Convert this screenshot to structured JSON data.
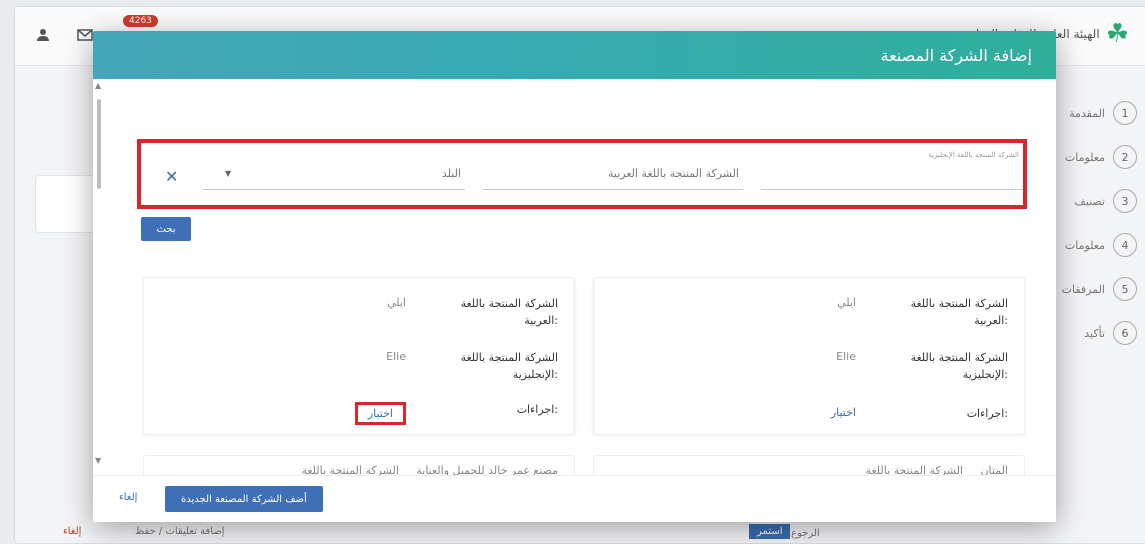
{
  "topbar": {
    "notification_count": "4263",
    "brand_text": "الهيئة العامة للغذاء والدواء"
  },
  "steps": [
    {
      "num": "1",
      "label": "المقدمة"
    },
    {
      "num": "2",
      "label": "معلومات"
    },
    {
      "num": "3",
      "label": "تصنيف"
    },
    {
      "num": "4",
      "label": "معلومات"
    },
    {
      "num": "5",
      "label": "المرفقات"
    },
    {
      "num": "6",
      "label": "تأكيد"
    }
  ],
  "background_footer": {
    "cancel": "إلغاء",
    "note": "إضافة تعليقات / حفظ",
    "next": "استمر",
    "back": "الرجوع"
  },
  "modal": {
    "title": "إضافة الشركة المصنعة",
    "search": {
      "country_placeholder": "البلد",
      "arabic_placeholder": "الشركة المنتجة باللغة العربية",
      "english_small_label": "الشركة المنتجة باللغة الإنجليزية",
      "search_button": "بحث"
    },
    "cards": [
      {
        "label_ar": "الشركة المنتجة باللغة العربية:",
        "value_ar": "ايلي",
        "label_en": "الشركة المنتجة باللغة الإنجليزية:",
        "value_en": "Elie",
        "label_actions": "اجراءات:",
        "action": "اختيار"
      },
      {
        "label_ar": "الشركة المنتجة باللغة العربية:",
        "value_ar": "ايلي",
        "label_en": "الشركة المنتجة باللغة الإنجليزية:",
        "value_en": "Elie",
        "label_actions": "اجراءات:",
        "action": "اختيار"
      }
    ],
    "partial_cards": [
      {
        "label": "الشركة المنتجة باللغة",
        "value": "مصنع عمر خالد للجميل والعناية"
      },
      {
        "label": "الشركة المنتجة باللغة",
        "value": "المتان"
      }
    ],
    "footer": {
      "add_new": "أضف الشركة المصنعة الجديدة",
      "cancel": "إلغاء"
    }
  },
  "colors": {
    "header_gradient_start": "#44a6b8",
    "header_gradient_end": "#2fae9b",
    "primary_button": "#3f6fb6",
    "highlight_border": "#d9252c"
  }
}
